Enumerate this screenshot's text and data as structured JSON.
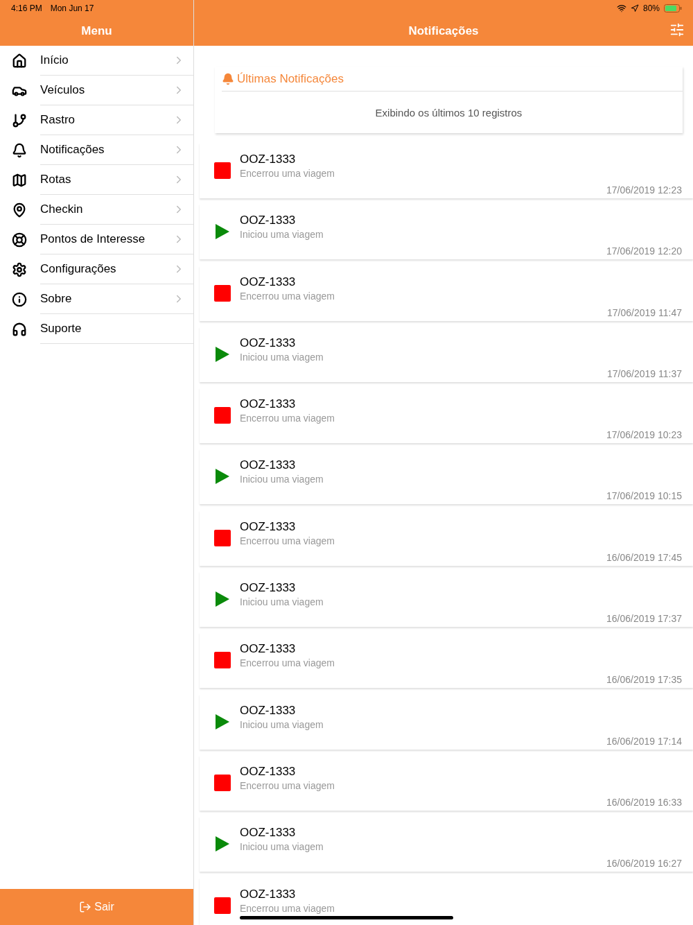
{
  "status_bar": {
    "time": "4:16 PM",
    "date": "Mon Jun 17",
    "battery": "80%"
  },
  "sidebar": {
    "title": "Menu",
    "items": [
      {
        "label": "Início",
        "chevron": true
      },
      {
        "label": "Veículos",
        "chevron": true
      },
      {
        "label": "Rastro",
        "chevron": true
      },
      {
        "label": "Notificações",
        "chevron": true
      },
      {
        "label": "Rotas",
        "chevron": true
      },
      {
        "label": "Checkin",
        "chevron": true
      },
      {
        "label": "Pontos de Interesse",
        "chevron": true
      },
      {
        "label": "Configurações",
        "chevron": true
      },
      {
        "label": "Sobre",
        "chevron": true
      },
      {
        "label": "Suporte",
        "chevron": false
      }
    ],
    "logout": "Sair"
  },
  "main": {
    "title": "Notificações",
    "card": {
      "title": "Últimas Notificações",
      "subtitle": "Exibindo os últimos 10 registros"
    },
    "notifications": [
      {
        "kind": "stop",
        "plate": "OOZ-1333",
        "message": "Encerrou uma viagem",
        "time": "17/06/2019 12:23"
      },
      {
        "kind": "start",
        "plate": "OOZ-1333",
        "message": "Iniciou uma viagem",
        "time": "17/06/2019 12:20"
      },
      {
        "kind": "stop",
        "plate": "OOZ-1333",
        "message": "Encerrou uma viagem",
        "time": "17/06/2019 11:47"
      },
      {
        "kind": "start",
        "plate": "OOZ-1333",
        "message": "Iniciou uma viagem",
        "time": "17/06/2019 11:37"
      },
      {
        "kind": "stop",
        "plate": "OOZ-1333",
        "message": "Encerrou uma viagem",
        "time": "17/06/2019 10:23"
      },
      {
        "kind": "start",
        "plate": "OOZ-1333",
        "message": "Iniciou uma viagem",
        "time": "17/06/2019 10:15"
      },
      {
        "kind": "stop",
        "plate": "OOZ-1333",
        "message": "Encerrou uma viagem",
        "time": "16/06/2019 17:45"
      },
      {
        "kind": "start",
        "plate": "OOZ-1333",
        "message": "Iniciou uma viagem",
        "time": "16/06/2019 17:37"
      },
      {
        "kind": "stop",
        "plate": "OOZ-1333",
        "message": "Encerrou uma viagem",
        "time": "16/06/2019 17:35"
      },
      {
        "kind": "start",
        "plate": "OOZ-1333",
        "message": "Iniciou uma viagem",
        "time": "16/06/2019 17:14"
      },
      {
        "kind": "stop",
        "plate": "OOZ-1333",
        "message": "Encerrou uma viagem",
        "time": "16/06/2019 16:33"
      },
      {
        "kind": "start",
        "plate": "OOZ-1333",
        "message": "Iniciou uma viagem",
        "time": "16/06/2019 16:27"
      },
      {
        "kind": "stop",
        "plate": "OOZ-1333",
        "message": "Encerrou uma viagem"
      }
    ]
  }
}
